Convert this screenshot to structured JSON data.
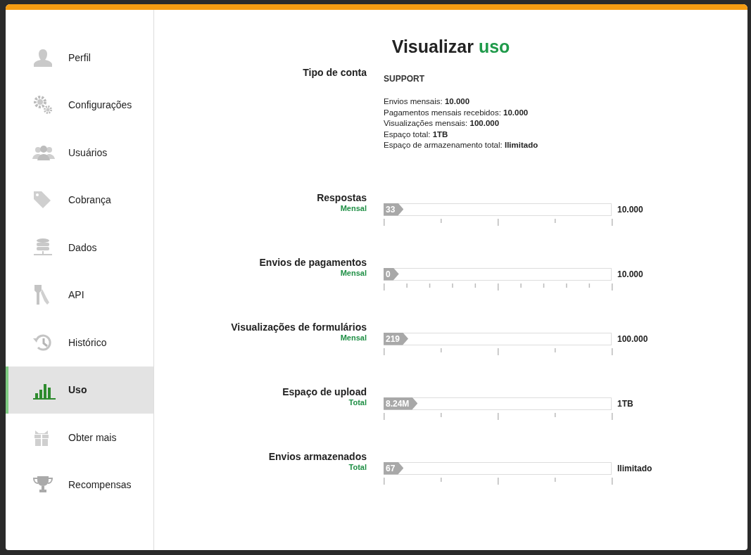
{
  "sidebar": {
    "items": [
      {
        "label": "Perfil",
        "selected": false
      },
      {
        "label": "Configurações",
        "selected": false
      },
      {
        "label": "Usuários",
        "selected": false
      },
      {
        "label": "Cobrança",
        "selected": false
      },
      {
        "label": "Dados",
        "selected": false
      },
      {
        "label": "API",
        "selected": false
      },
      {
        "label": "Histórico",
        "selected": false
      },
      {
        "label": "Uso",
        "selected": true
      },
      {
        "label": "Obter mais",
        "selected": false
      },
      {
        "label": "Recompensas",
        "selected": false
      }
    ]
  },
  "page": {
    "title": "Visualizar",
    "title_accent": "uso"
  },
  "account": {
    "label": "Tipo de conta",
    "plan": "SUPPORT",
    "details": [
      "Envios mensais: **10.000**",
      "Pagamentos mensais recebidos: **10.000**",
      "Visualizações mensais: **100.000**",
      "Espaço total: **1TB**",
      "Espaço de armazenamento total: **Ilimitado**"
    ]
  },
  "meters": [
    {
      "label": "Respostas",
      "period": "Mensal",
      "value": "33",
      "level": 0.0033,
      "limit": "10.000"
    },
    {
      "label": "Envios de pagamentos",
      "period": "Mensal",
      "value": "0",
      "level": 0,
      "limit": "10.000"
    },
    {
      "label": "Visualizações de formulários",
      "period": "Mensal",
      "value": "219",
      "level": 0.0022,
      "limit": "100.000"
    },
    {
      "label": "Espaço de upload",
      "period": "Total",
      "value": "8.24M",
      "level": 0.0001,
      "limit": "1TB"
    },
    {
      "label": "Envios armazenados",
      "period": "Total",
      "value": "67",
      "level": 0,
      "limit": "Ilimitado"
    }
  ]
}
